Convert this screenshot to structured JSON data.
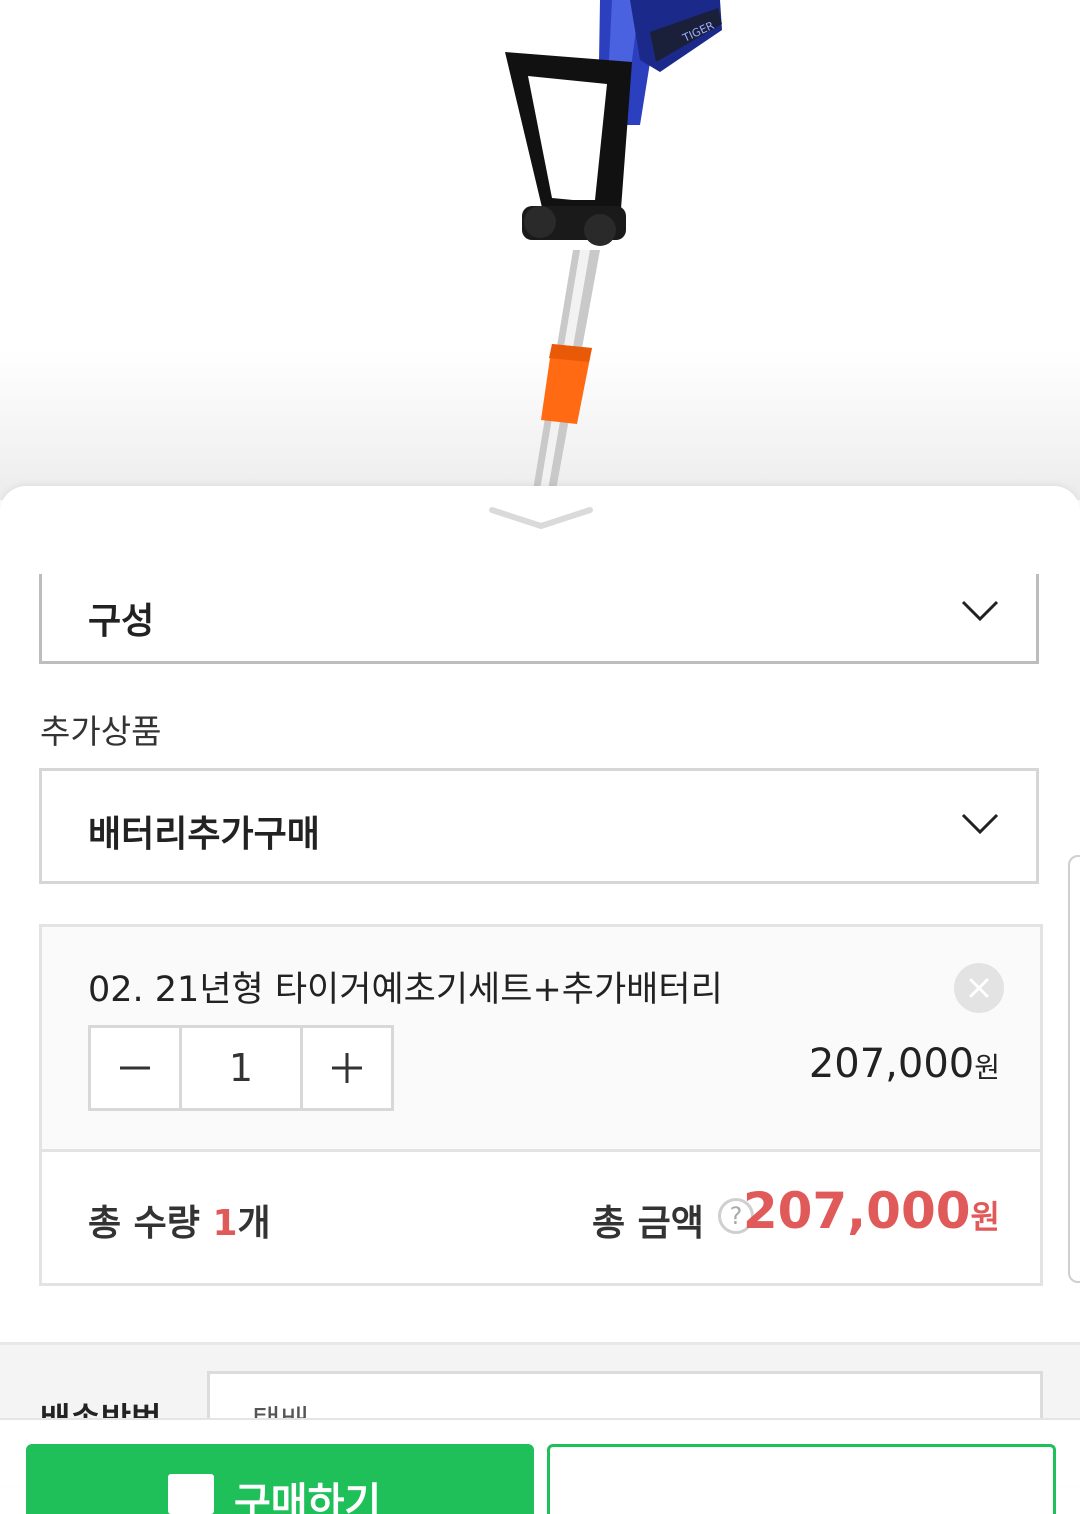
{
  "product_image": {
    "brand_text": "TIGER"
  },
  "sheet": {
    "config_select": {
      "label": "구성"
    },
    "addon_section_label": "추가상품",
    "addon_select": {
      "label": "배터리추가구매"
    },
    "selected_item": {
      "name": "02. 21년형 타이거예초기세트+추가배터리",
      "quantity": "1",
      "price": "207,000",
      "price_unit": "원"
    },
    "totals": {
      "qty_prefix": "총 수량 ",
      "qty_value": "1",
      "qty_suffix": "개",
      "amount_label": "총 금액",
      "help_symbol": "?",
      "amount": "207,000",
      "amount_unit": "원"
    },
    "shipping": {
      "label": "배송방법",
      "value": "택배"
    }
  },
  "bottom_bar": {
    "buy_label": "구매하기"
  },
  "colors": {
    "accent_green": "#1fbf5a",
    "price_red": "#e05a5a"
  }
}
